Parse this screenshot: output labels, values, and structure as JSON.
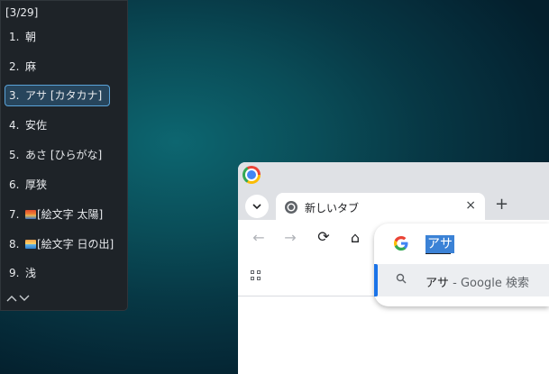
{
  "ime": {
    "counter": "[3/29]",
    "candidates": [
      {
        "num": "1.",
        "text": "朝",
        "emoji": ""
      },
      {
        "num": "2.",
        "text": "麻",
        "emoji": ""
      },
      {
        "num": "3.",
        "text": "アサ [カタカナ]",
        "emoji": ""
      },
      {
        "num": "4.",
        "text": "安佐",
        "emoji": ""
      },
      {
        "num": "5.",
        "text": "あさ [ひらがな]",
        "emoji": ""
      },
      {
        "num": "6.",
        "text": "厚狭",
        "emoji": ""
      },
      {
        "num": "7.",
        "text": "[絵文字 太陽]",
        "emoji": "sunset-emoji"
      },
      {
        "num": "8.",
        "text": "[絵文字 日の出]",
        "emoji": "sunrise-emoji"
      },
      {
        "num": "9.",
        "text": "浅",
        "emoji": ""
      }
    ],
    "selected_index": 2,
    "prev_label": "^",
    "next_label": "v"
  },
  "browser": {
    "tab_search_label": "⌄",
    "tab_title": "新しいタブ",
    "tab_close_label": "×",
    "new_tab_label": "+",
    "nav": {
      "back": "←",
      "forward": "→",
      "reload": "⟳",
      "home": "⌂"
    }
  },
  "omnibox": {
    "input_value": "アサ",
    "suggestion_query": "アサ",
    "suggestion_sep": " - ",
    "suggestion_engine": "Google 検索"
  },
  "colors": {
    "accent": "#1a73e8",
    "ime_selected_border": "#5aa3d9",
    "ime_background": "#1e2328"
  }
}
